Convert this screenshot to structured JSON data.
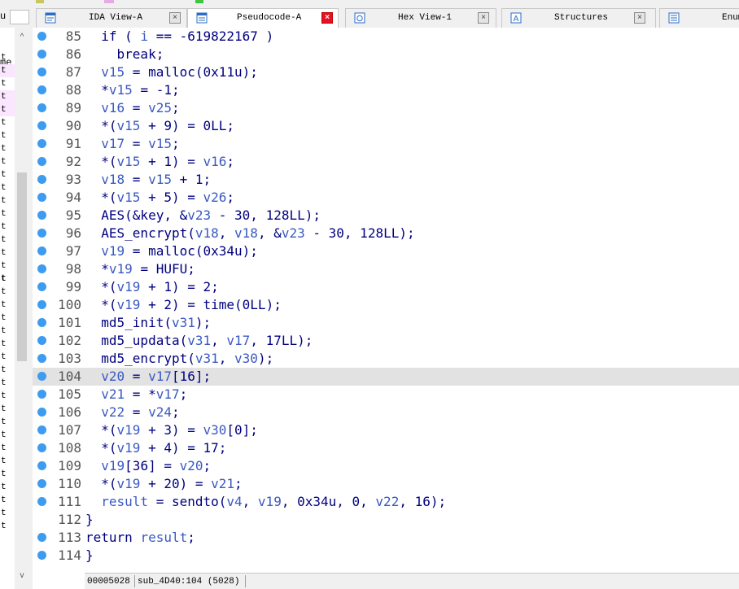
{
  "tabs": [
    {
      "label": "IDA View-A",
      "icon": "ida-view-icon",
      "active": false
    },
    {
      "label": "Pseudocode-A",
      "icon": "pseudocode-icon",
      "active": true
    },
    {
      "label": "Hex View-1",
      "icon": "hex-view-icon",
      "active": false
    },
    {
      "label": "Structures",
      "icon": "structures-icon",
      "active": false
    },
    {
      "label": "Enum",
      "icon": "enums-icon",
      "active": false
    }
  ],
  "close_glyph": "×",
  "left_panel": {
    "header_fragment": "u",
    "name_fragment": "me",
    "rows": [
      "t",
      "t",
      "t",
      "t",
      "t",
      "t",
      "t",
      "t",
      "t",
      "t",
      "t",
      "t",
      "t",
      "t",
      "t",
      "t",
      "t",
      "t",
      "t",
      "t",
      "t",
      "t",
      "t",
      "t",
      "t",
      "t",
      "t",
      "t",
      "t",
      "t",
      "t",
      "t",
      "t",
      "t",
      "t",
      "t",
      "t"
    ]
  },
  "code_lines": [
    {
      "no": "85",
      "text": "  if ( i == -619822167 )"
    },
    {
      "no": "86",
      "text": "    break;"
    },
    {
      "no": "87",
      "text": "  v15 = malloc(0x11u);"
    },
    {
      "no": "88",
      "text": "  *v15 = -1;"
    },
    {
      "no": "89",
      "text": "  v16 = v25;"
    },
    {
      "no": "90",
      "text": "  *(v15 + 9) = 0LL;"
    },
    {
      "no": "91",
      "text": "  v17 = v15;"
    },
    {
      "no": "92",
      "text": "  *(v15 + 1) = v16;"
    },
    {
      "no": "93",
      "text": "  v18 = v15 + 1;"
    },
    {
      "no": "94",
      "text": "  *(v15 + 5) = v26;"
    },
    {
      "no": "95",
      "text": "  AES(&key, &v23 - 30, 128LL);"
    },
    {
      "no": "96",
      "text": "  AES_encrypt(v18, v18, &v23 - 30, 128LL);"
    },
    {
      "no": "97",
      "text": "  v19 = malloc(0x34u);"
    },
    {
      "no": "98",
      "text": "  *v19 = HUFU;"
    },
    {
      "no": "99",
      "text": "  *(v19 + 1) = 2;"
    },
    {
      "no": "100",
      "text": "  *(v19 + 2) = time(0LL);"
    },
    {
      "no": "101",
      "text": "  md5_init(v31);"
    },
    {
      "no": "102",
      "text": "  md5_updata(v31, v17, 17LL);"
    },
    {
      "no": "103",
      "text": "  md5_encrypt(v31, v30);"
    },
    {
      "no": "104",
      "text": "  v20 = v17[16];",
      "highlight": true
    },
    {
      "no": "105",
      "text": "  v21 = *v17;"
    },
    {
      "no": "106",
      "text": "  v22 = v24;"
    },
    {
      "no": "107",
      "text": "  *(v19 + 3) = v30[0];"
    },
    {
      "no": "108",
      "text": "  *(v19 + 4) = 17;"
    },
    {
      "no": "109",
      "text": "  v19[36] = v20;"
    },
    {
      "no": "110",
      "text": "  *(v19 + 20) = v21;"
    },
    {
      "no": "111",
      "text": "  result = sendto(v4, v19, 0x34u, 0, v22, 16);"
    },
    {
      "no": "112",
      "text": "}",
      "no_bp": true
    },
    {
      "no": "113",
      "text": "return result;"
    },
    {
      "no": "114",
      "text": "}"
    }
  ],
  "status_bar": {
    "address": "00005028",
    "location": "sub_4D40:104 (5028)"
  },
  "colors": {
    "code_text": "#000080",
    "variable": "#3a59c2",
    "breakpoint": "#3d9bf0",
    "highlight_line": "#e2e2e2",
    "active_close": "#e81123"
  }
}
